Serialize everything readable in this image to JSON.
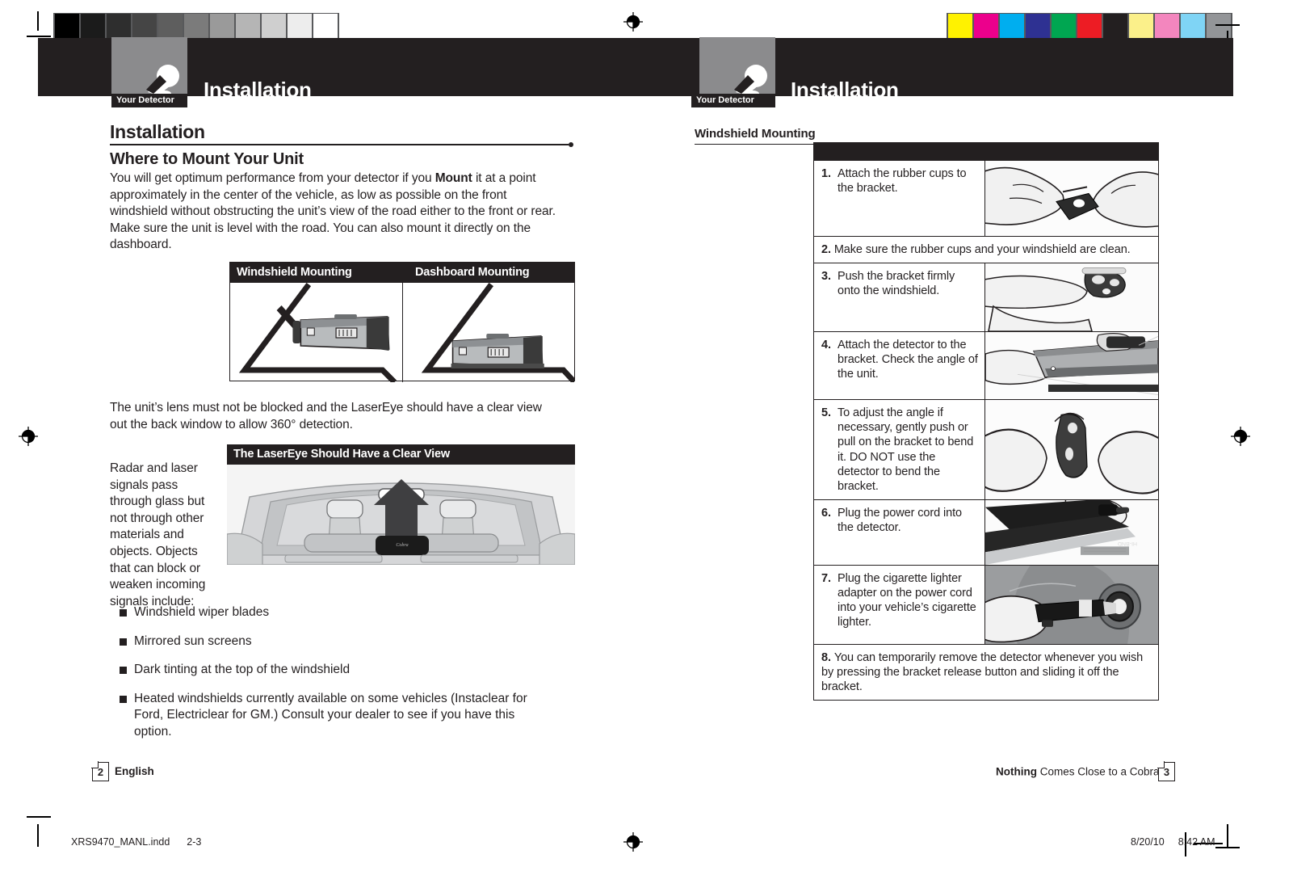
{
  "print_marks": {
    "gray_ramp": [
      "#000000",
      "#1b1b1b",
      "#2e2e2e",
      "#454545",
      "#5e5e5e",
      "#7b7b7b",
      "#9a9a9a",
      "#b5b5b5",
      "#cfcfcf",
      "#ededed",
      "#ffffff"
    ],
    "color_bar": [
      "#fff200",
      "#ec008c",
      "#00aeef",
      "#2e3192",
      "#00a651",
      "#ed1c24",
      "#231f20",
      "#fbf08a",
      "#f островf",
      "#f386be",
      "#7fd4f5",
      "#939598"
    ],
    "color_bar_fixed": [
      "#fff200",
      "#ec008c",
      "#00aeef",
      "#2e3192",
      "#00a651",
      "#ed1c24",
      "#231f20",
      "#fbf08a",
      "#f386be",
      "#7fd4f5",
      "#939598"
    ]
  },
  "header": {
    "left": {
      "tab_label": "Your Detector",
      "title": "Installation",
      "icon": "detector-icon"
    },
    "right": {
      "tab_label": "Your Detector",
      "title": "Installation",
      "icon": "detector-icon"
    }
  },
  "left_page": {
    "section_title": "Installation",
    "subsection_title": "Where to Mount Your Unit",
    "intro_parts": {
      "a": "You will get optimum performance from your detector if you ",
      "bold": "Mount",
      "b": " it at a point approximately in the center of the vehicle, as low as possible on the front windshield without obstructing the unit’s view of the road either to the front or rear. Make sure the unit is level with the road. You can also mount it directly on the dashboard."
    },
    "mounting_figure": {
      "captions": [
        "Windshield Mounting",
        "Dashboard Mounting"
      ]
    },
    "lens_note": "The unit’s lens must not be blocked and the LaserEye should have a clear view out the back window to allow 360° detection.",
    "lasereye_figure": {
      "caption": "The LaserEye Should Have a Clear View",
      "device_label": "Cobra"
    },
    "signals_text": "Radar and laser signals pass through glass but not through other materials and objects. Objects that can block or weaken incoming signals include:",
    "blockers": [
      "Windshield wiper blades",
      "Mirrored sun screens",
      "Dark tinting at the top of the windshield",
      "Heated windshields currently available on some vehicles (Instaclear for Ford, Electriclear for GM.) Consult your dealer to see if you have this option."
    ],
    "footer": {
      "page_number": "2",
      "language": "English"
    }
  },
  "right_page": {
    "section_title": "Windshield Mounting",
    "steps": [
      {
        "num": "1.",
        "text": "Attach the rubber cups to the bracket.",
        "has_image": true,
        "image": "hands-attaching-rubber-cups"
      },
      {
        "num": "2.",
        "text": "Make sure the rubber cups and your windshield are clean.",
        "has_image": false,
        "image": ""
      },
      {
        "num": "3.",
        "text": "Push the bracket firmly onto the windshield.",
        "has_image": true,
        "image": "hand-pushing-bracket-windshield"
      },
      {
        "num": "4.",
        "text": "Attach the detector to the bracket. Check the angle of the unit.",
        "has_image": true,
        "image": "hands-attaching-detector-bracket"
      },
      {
        "num": "5.",
        "text": "To adjust the angle if necessary, gently push or pull on the bracket to bend it. DO NOT use the detector to bend the bracket.",
        "has_image": true,
        "image": "hands-bending-bracket"
      },
      {
        "num": "6.",
        "text": "Plug the power cord into the detector.",
        "has_image": true,
        "image": "power-cord-into-detector"
      },
      {
        "num": "7.",
        "text": "Plug the cigarette lighter adapter on the power cord into your vehicle’s cigarette lighter.",
        "has_image": true,
        "image": "lighter-adapter-into-socket"
      },
      {
        "num": "8.",
        "text": "You can temporarily remove the detector whenever you wish by pressing the bracket release button and sliding it off the bracket.",
        "has_image": false,
        "image": ""
      }
    ],
    "footer": {
      "page_number": "3",
      "tagline_bold": "Nothing",
      "tagline_rest": " Comes Close to a Cobra",
      "tagline_sup": "®"
    }
  },
  "print_info": {
    "file": "XRS9470_MANL.indd",
    "spread": "2-3",
    "date": "8/20/10",
    "time": "8:42 AM"
  }
}
